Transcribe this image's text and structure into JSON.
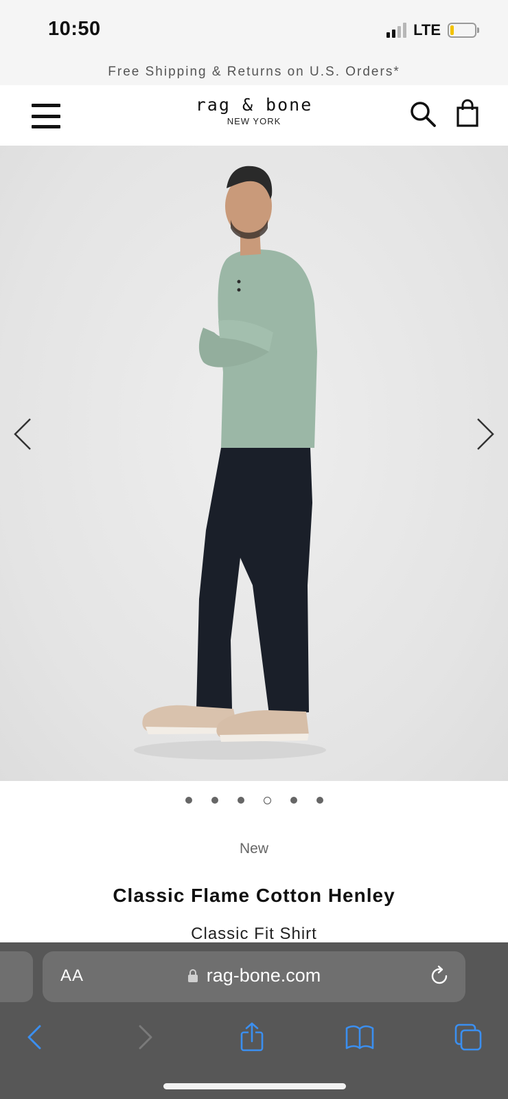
{
  "status_bar": {
    "time": "10:50",
    "network": "LTE",
    "battery_level": 0.15
  },
  "promo": {
    "text": "Free Shipping & Returns on U.S. Orders*"
  },
  "header": {
    "logo_text": "rag & bone",
    "logo_subtext": "NEW YORK"
  },
  "gallery": {
    "image_count": 6,
    "active_index": 3
  },
  "product": {
    "badge": "New",
    "title": "Classic Flame Cotton Henley",
    "subtitle": "Classic Fit Shirt"
  },
  "browser": {
    "text_size_label": "AA",
    "url": "rag-bone.com"
  },
  "colors": {
    "accent_link": "#3b8ff0",
    "browser_bar": "#575757",
    "shirt": "#9bb7a6",
    "pants": "#1a1f29"
  }
}
